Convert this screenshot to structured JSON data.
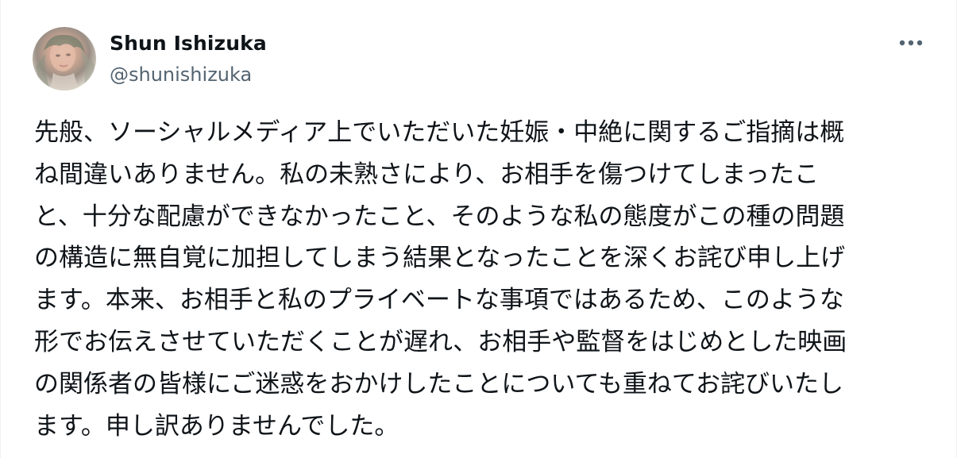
{
  "author": {
    "display_name": "Shun Ishizuka",
    "handle": "@shunishizuka"
  },
  "icons": {
    "avatar": "profile-photo",
    "more": "more-horizontal-icon"
  },
  "tweet": {
    "lines": [
      "先般、ソーシャルメディア上でいただいた妊娠・中絶に関するご指摘は概",
      "ね間違いありません。私の未熟さにより、お相手を傷つけてしまったこ",
      "と、十分な配慮ができなかったこと、そのような私の態度がこの種の問題",
      "の構造に無自覚に加担してしまう結果となったことを深くお詫び申し上げ",
      "ます。本来、お相手と私のプライベートな事項ではあるため、このような",
      "形でお伝えさせていただくことが遅れ、お相手や監督をはじめとした映画",
      "の関係者の皆様にご迷惑をおかけしたことについても重ねてお詫びいたし",
      "ます。申し訳ありませんでした。"
    ]
  },
  "colors": {
    "text_primary": "#0f1419",
    "text_secondary": "#536471",
    "border": "#eff3f4"
  }
}
